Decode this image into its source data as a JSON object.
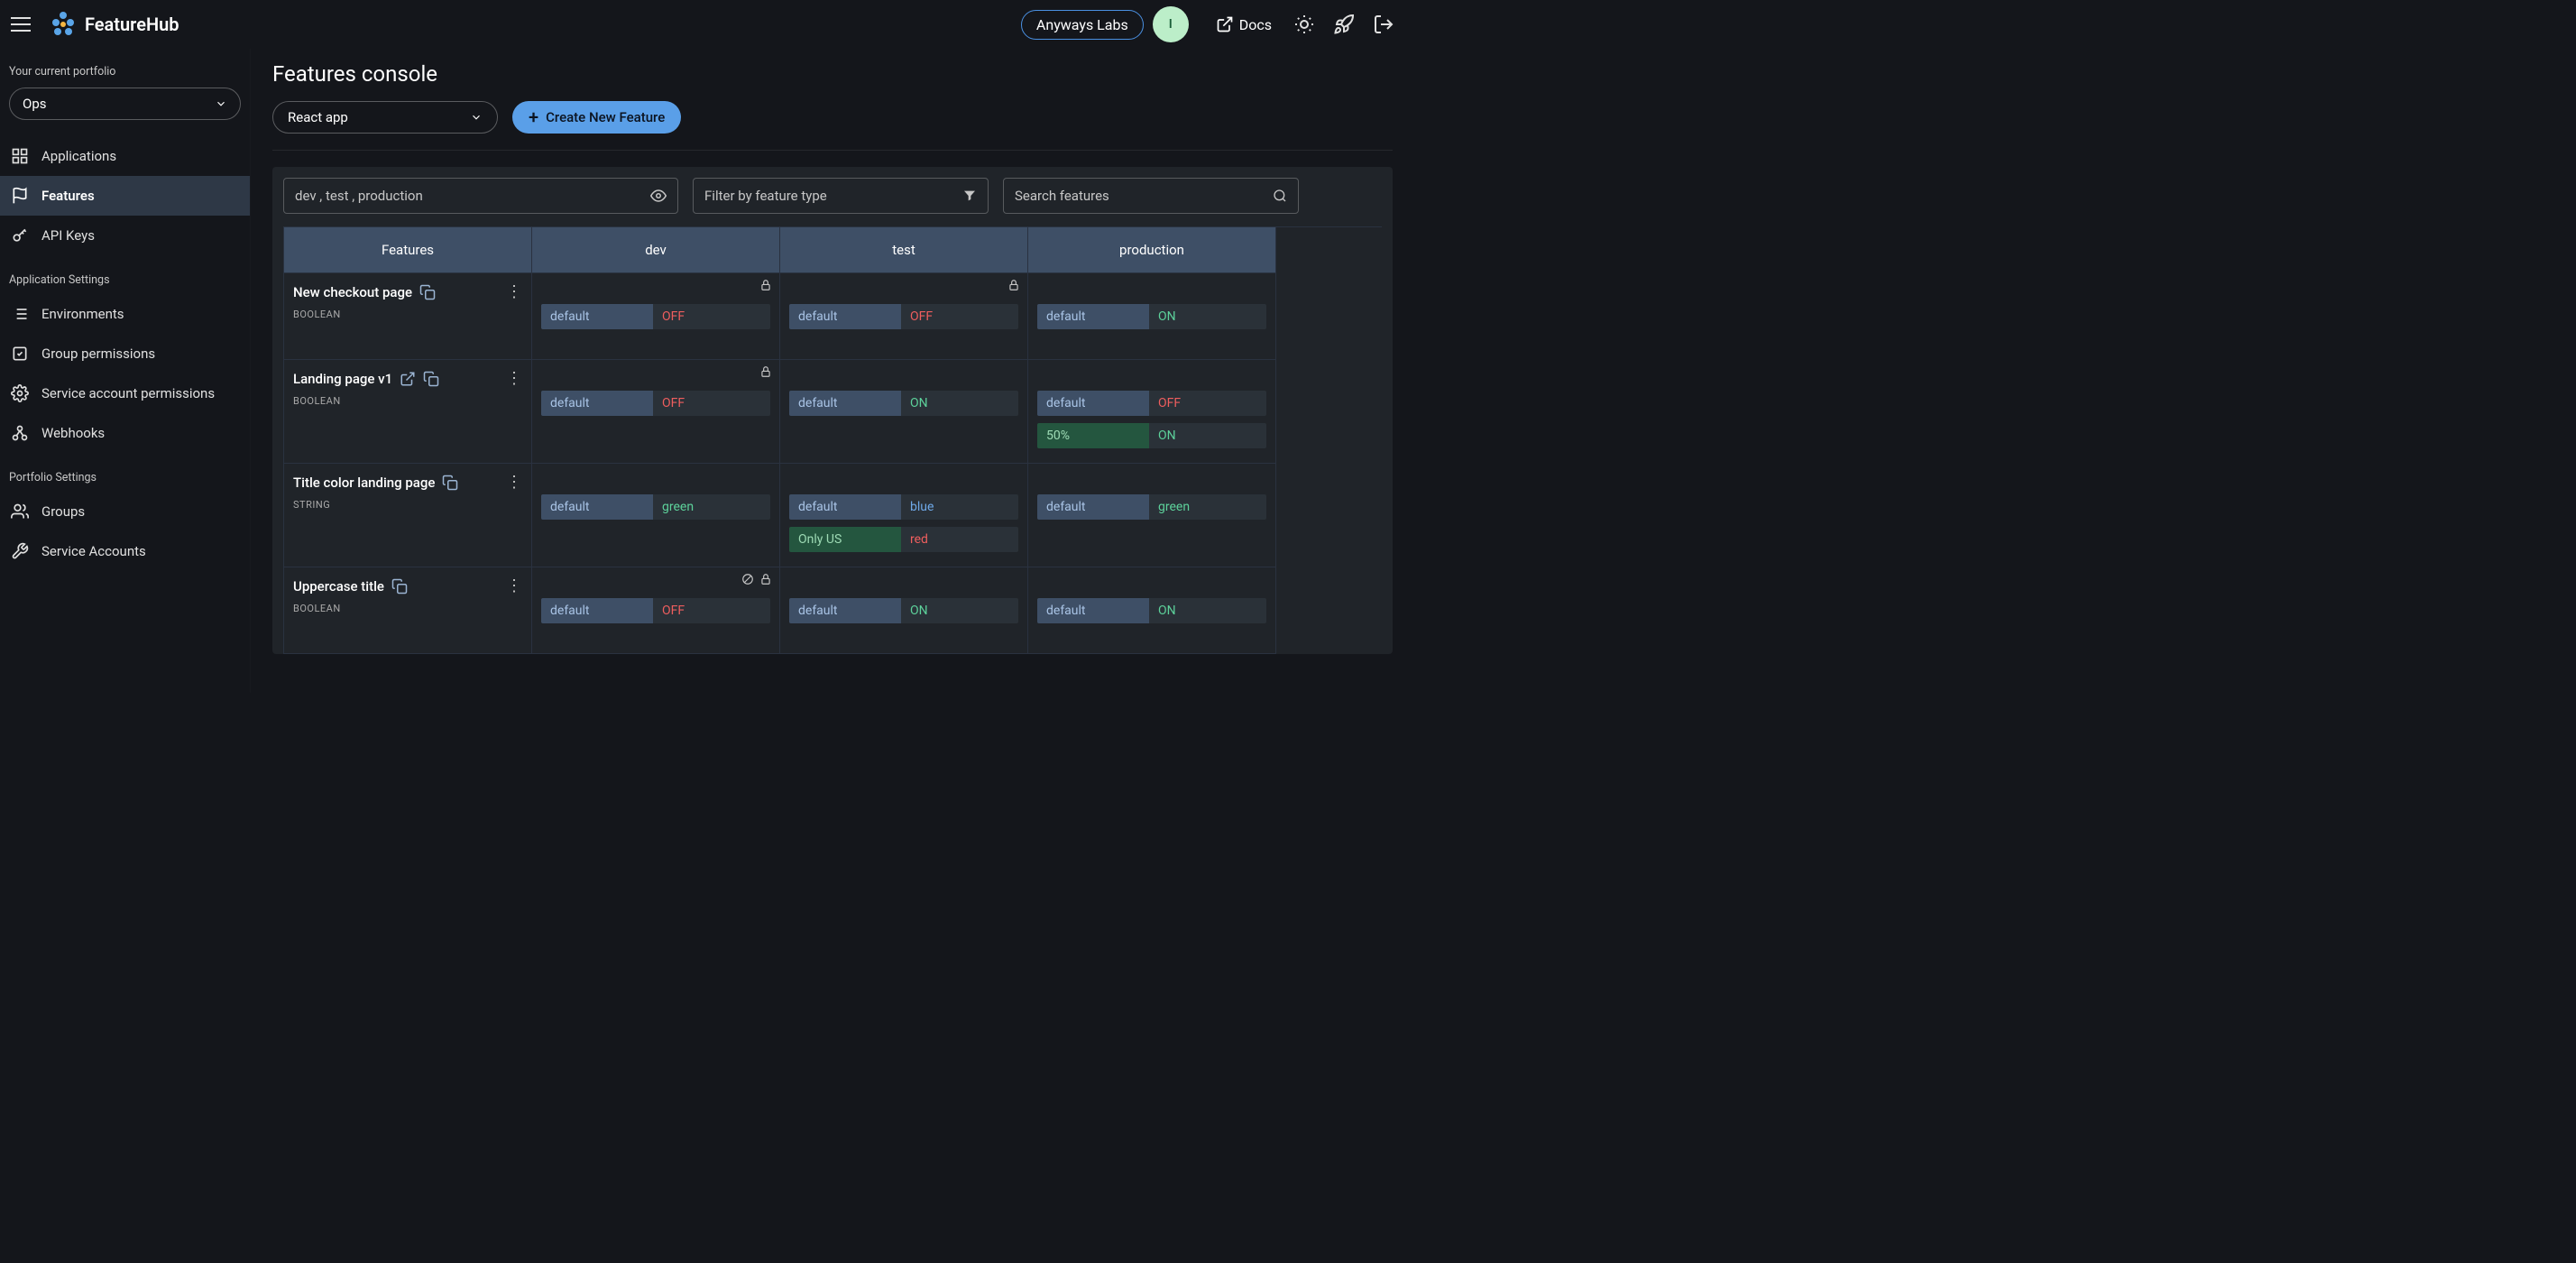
{
  "header": {
    "brand": "FeatureHub",
    "org_chip": "Anyways Labs",
    "avatar_initial": "I",
    "docs_label": "Docs"
  },
  "sidebar": {
    "portfolio_label": "Your current portfolio",
    "portfolio_value": "Ops",
    "nav": [
      {
        "label": "Applications"
      },
      {
        "label": "Features"
      },
      {
        "label": "API Keys"
      }
    ],
    "app_settings_label": "Application Settings",
    "app_settings": [
      {
        "label": "Environments"
      },
      {
        "label": "Group permissions"
      },
      {
        "label": "Service account permissions"
      },
      {
        "label": "Webhooks"
      }
    ],
    "portfolio_settings_label": "Portfolio Settings",
    "portfolio_settings": [
      {
        "label": "Groups"
      },
      {
        "label": "Service Accounts"
      }
    ]
  },
  "main": {
    "title": "Features console",
    "app_select": "React app",
    "create_btn": "Create New Feature",
    "filters": {
      "env_value": "dev , test , production",
      "type_placeholder": "Filter by feature type",
      "search_placeholder": "Search features"
    },
    "columns": [
      "Features",
      "dev",
      "test",
      "production"
    ],
    "rows": [
      {
        "name": "New checkout page",
        "type": "BOOLEAN",
        "has_link": false,
        "cells": [
          {
            "locked": true,
            "blocked": false,
            "tags": [
              {
                "label": "default",
                "style": "blue",
                "value": "OFF",
                "vstyle": "off"
              }
            ]
          },
          {
            "locked": true,
            "blocked": false,
            "tags": [
              {
                "label": "default",
                "style": "blue",
                "value": "OFF",
                "vstyle": "off"
              }
            ]
          },
          {
            "locked": false,
            "blocked": false,
            "tags": [
              {
                "label": "default",
                "style": "blue",
                "value": "ON",
                "vstyle": "on"
              }
            ]
          }
        ]
      },
      {
        "name": "Landing page v1",
        "type": "BOOLEAN",
        "has_link": true,
        "cells": [
          {
            "locked": true,
            "blocked": false,
            "tags": [
              {
                "label": "default",
                "style": "blue",
                "value": "OFF",
                "vstyle": "off"
              }
            ]
          },
          {
            "locked": false,
            "blocked": false,
            "tags": [
              {
                "label": "default",
                "style": "blue",
                "value": "ON",
                "vstyle": "on"
              }
            ]
          },
          {
            "locked": false,
            "blocked": false,
            "tags": [
              {
                "label": "default",
                "style": "blue",
                "value": "OFF",
                "vstyle": "off"
              },
              {
                "label": "50%",
                "style": "green",
                "value": "ON",
                "vstyle": "on"
              }
            ]
          }
        ]
      },
      {
        "name": "Title color landing page",
        "type": "STRING",
        "has_link": false,
        "cells": [
          {
            "locked": false,
            "blocked": false,
            "tags": [
              {
                "label": "default",
                "style": "blue",
                "value": "green",
                "vstyle": "tgreen"
              }
            ]
          },
          {
            "locked": false,
            "blocked": false,
            "tags": [
              {
                "label": "default",
                "style": "blue",
                "value": "blue",
                "vstyle": "tblue"
              },
              {
                "label": "Only US",
                "style": "green",
                "value": "red",
                "vstyle": "tred"
              }
            ]
          },
          {
            "locked": false,
            "blocked": false,
            "tags": [
              {
                "label": "default",
                "style": "blue",
                "value": "green",
                "vstyle": "tgreen"
              }
            ]
          }
        ]
      },
      {
        "name": "Uppercase title",
        "type": "BOOLEAN",
        "has_link": false,
        "cells": [
          {
            "locked": true,
            "blocked": true,
            "tags": [
              {
                "label": "default",
                "style": "blue",
                "value": "OFF",
                "vstyle": "off"
              }
            ]
          },
          {
            "locked": false,
            "blocked": false,
            "tags": [
              {
                "label": "default",
                "style": "blue",
                "value": "ON",
                "vstyle": "on"
              }
            ]
          },
          {
            "locked": false,
            "blocked": false,
            "tags": [
              {
                "label": "default",
                "style": "blue",
                "value": "ON",
                "vstyle": "on"
              }
            ]
          }
        ]
      }
    ]
  }
}
